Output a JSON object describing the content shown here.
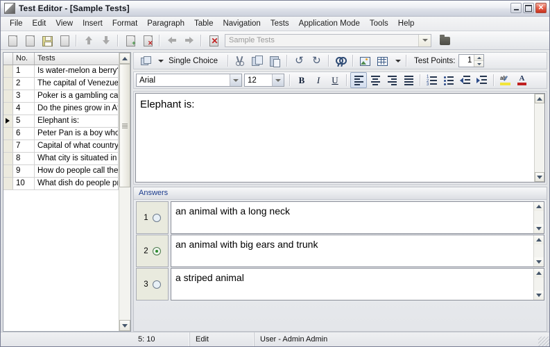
{
  "window": {
    "title": "Test Editor - [Sample Tests]",
    "icon": "app-icon",
    "buttons": {
      "minimize": "minimize",
      "maximize": "maximize",
      "close": "close"
    }
  },
  "menu": {
    "items": [
      {
        "label": "File"
      },
      {
        "label": "Edit"
      },
      {
        "label": "View"
      },
      {
        "label": "Insert"
      },
      {
        "label": "Format"
      },
      {
        "label": "Paragraph"
      },
      {
        "label": "Table"
      },
      {
        "label": "Navigation"
      },
      {
        "label": "Tests"
      },
      {
        "label": "Application Mode"
      },
      {
        "label": "Tools"
      },
      {
        "label": "Help"
      }
    ]
  },
  "toolbar": {
    "buttons": [
      {
        "name": "new-icon",
        "title": "New"
      },
      {
        "name": "open-icon",
        "title": "Open"
      },
      {
        "name": "save-icon",
        "title": "Save"
      },
      {
        "name": "print-icon",
        "title": "Print"
      },
      {
        "name": "move-up-icon",
        "title": "Move Up"
      },
      {
        "name": "move-down-icon",
        "title": "Move Down"
      },
      {
        "name": "add-question-icon",
        "title": "Add Question"
      },
      {
        "name": "delete-question-icon",
        "title": "Delete Question"
      },
      {
        "name": "previous-icon",
        "title": "Previous"
      },
      {
        "name": "next-icon",
        "title": "Next"
      },
      {
        "name": "delete-test-icon",
        "title": "Delete Test"
      }
    ],
    "test_combo": {
      "value": "Sample Tests",
      "placeholder": "Sample Tests"
    },
    "browse_icon": "folder-icon"
  },
  "test_list": {
    "columns": {
      "indicator": "",
      "no": "No.",
      "tests": "Tests"
    },
    "selected_row": 5,
    "rows": [
      {
        "no": "1",
        "text": "Is water-melon a berry?"
      },
      {
        "no": "2",
        "text": "The capital of Venezuela is"
      },
      {
        "no": "3",
        "text": "Poker is a gambling card game"
      },
      {
        "no": "4",
        "text": "Do the pines grow in Africa?"
      },
      {
        "no": "5",
        "text": "Elephant is:"
      },
      {
        "no": "6",
        "text": "Peter Pan is a boy who had"
      },
      {
        "no": "7",
        "text": "Capital of what country is"
      },
      {
        "no": "8",
        "text": "What city is situated in G"
      },
      {
        "no": "9",
        "text": "How do people call the c"
      },
      {
        "no": "10",
        "text": "What dish do people pref"
      }
    ]
  },
  "editor_toolbar": {
    "question_type": {
      "label": "Single Choice",
      "icon": "question-type-icon"
    },
    "buttons": [
      {
        "name": "cut-icon",
        "title": "Cut"
      },
      {
        "name": "copy-icon",
        "title": "Copy"
      },
      {
        "name": "paste-icon",
        "title": "Paste"
      },
      {
        "name": "undo-icon",
        "title": "Undo"
      },
      {
        "name": "redo-icon",
        "title": "Redo"
      },
      {
        "name": "find-icon",
        "title": "Find"
      },
      {
        "name": "insert-image-icon",
        "title": "Insert Image"
      },
      {
        "name": "insert-table-icon",
        "title": "Insert Table"
      }
    ],
    "test_points": {
      "label": "Test Points:",
      "value": "1"
    }
  },
  "format_toolbar": {
    "font_name": "Arial",
    "font_size": "12",
    "bold": "B",
    "italic": "I",
    "underline": "U",
    "align_left": "align-left",
    "align_center": "align-center",
    "align_right": "align-right",
    "align_justify": "align-justify",
    "numbered_list": "numbered-list",
    "bullet_list": "bullet-list",
    "decrease_indent": "decrease-indent",
    "increase_indent": "increase-indent",
    "highlight": "ab",
    "font_color": "A",
    "active_alignment": "align-left"
  },
  "question_editor": {
    "text": "Elephant is:"
  },
  "answers": {
    "title": "Answers",
    "correct_index": 2,
    "items": [
      {
        "no": "1",
        "text": "an animal with a long neck",
        "correct": false
      },
      {
        "no": "2",
        "text": "an animal with big ears and trunk",
        "correct": true
      },
      {
        "no": "3",
        "text": "a striped animal",
        "correct": false
      }
    ]
  },
  "status_bar": {
    "position": "5: 10",
    "mode": "Edit",
    "user": "User - Admin Admin"
  },
  "colors": {
    "accent": "#1a3a8c",
    "correct": "#2e8b2e",
    "close": "#c8301c",
    "window_bg": "#e3e5e8"
  }
}
